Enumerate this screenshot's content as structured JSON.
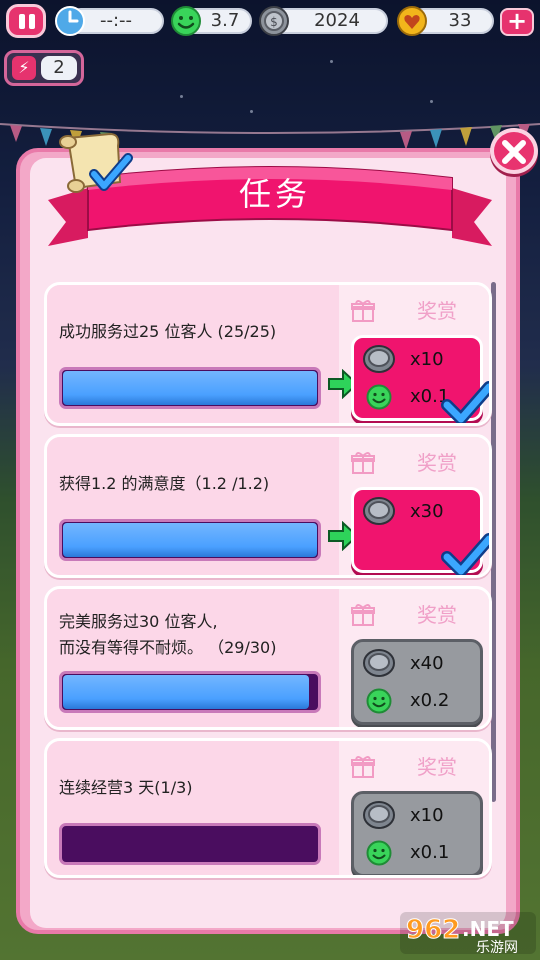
{
  "hud": {
    "timer": "--:--",
    "satisfaction": "3.7",
    "coins": "2024",
    "hearts": "33",
    "energy": "2"
  },
  "modal": {
    "title": "任务"
  },
  "tasks": [
    {
      "text": "成功服务过25 位客人 (25/25)",
      "progress": 1.0,
      "reward_label": "奖赏",
      "status": "completed",
      "rewards": [
        {
          "icon": "coin-icon",
          "value": "x10"
        },
        {
          "icon": "smile-icon",
          "value": "x0.1"
        }
      ]
    },
    {
      "text": "获得1.2 的满意度（1.2 /1.2)",
      "progress": 1.0,
      "reward_label": "奖赏",
      "status": "completed",
      "rewards": [
        {
          "icon": "coin-icon",
          "value": "x30"
        }
      ]
    },
    {
      "text_line1": "完美服务过30 位客人,",
      "text_line2": " 而没有等得不耐烦。 （29/30)",
      "progress": 0.97,
      "reward_label": "奖赏",
      "status": "pending",
      "rewards": [
        {
          "icon": "coin-icon",
          "value": "x40"
        },
        {
          "icon": "smile-icon",
          "value": "x0.2"
        }
      ]
    },
    {
      "text": "连续经营3 天(1/3)",
      "progress": 0.0,
      "reward_label": "奖赏",
      "status": "pending",
      "rewards": [
        {
          "icon": "coin-icon",
          "value": "x10"
        },
        {
          "icon": "smile-icon",
          "value": "x0.1"
        }
      ]
    }
  ],
  "watermark": {
    "brand": "962",
    "suffix": ".NET",
    "sub": "乐游网"
  },
  "colors": {
    "accent_pink": "#e6336e",
    "reward_done": "#f0146e",
    "reward_pending": "#979a9f",
    "progress_blue": "#4aa0ff",
    "progress_track": "#4a0d5f"
  }
}
